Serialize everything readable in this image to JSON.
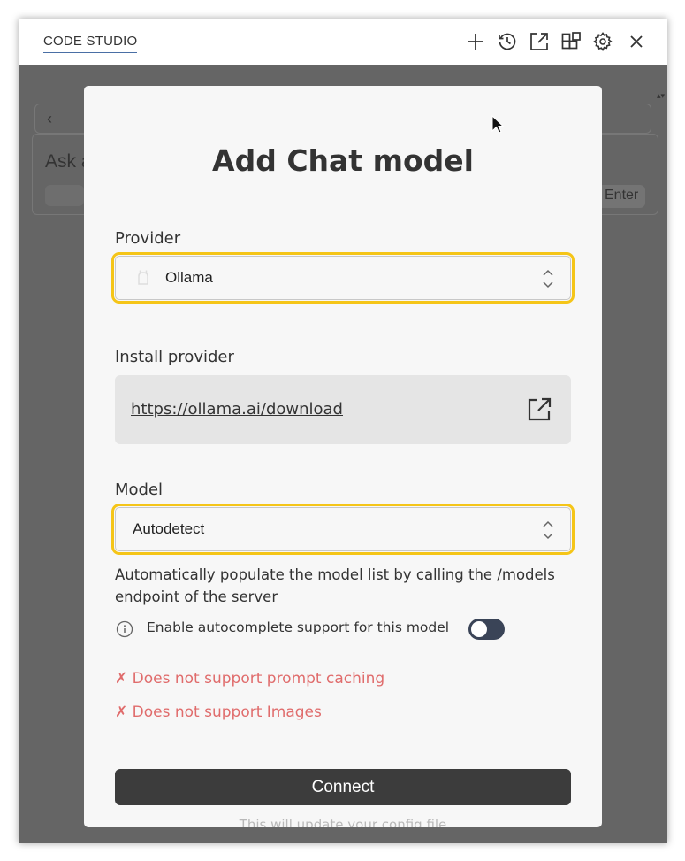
{
  "window": {
    "title": "CODE STUDIO",
    "toolbar": [
      "plus-icon",
      "history-icon",
      "external-open-icon",
      "layout-icon",
      "gear-icon",
      "close-icon"
    ]
  },
  "background": {
    "ask_text": "Ask a",
    "enter_label": "Enter"
  },
  "modal": {
    "title": "Add Chat model",
    "provider": {
      "label": "Provider",
      "value": "Ollama"
    },
    "install": {
      "label": "Install provider",
      "link": "https://ollama.ai/download"
    },
    "model": {
      "label": "Model",
      "value": "Autodetect",
      "description": "Automatically populate the model list by calling the /models endpoint of the server"
    },
    "autocomplete": {
      "label": "Enable autocomplete support for this model",
      "enabled": false
    },
    "warnings": [
      "✗ Does not support prompt caching",
      "✗ Does not support Images"
    ],
    "connect_label": "Connect",
    "footnote": "This will update your config file"
  },
  "colors": {
    "highlight": "#f5c518",
    "warning": "#e06c6c",
    "toggle_off": "#3a4457",
    "button": "#3c3c3c"
  }
}
